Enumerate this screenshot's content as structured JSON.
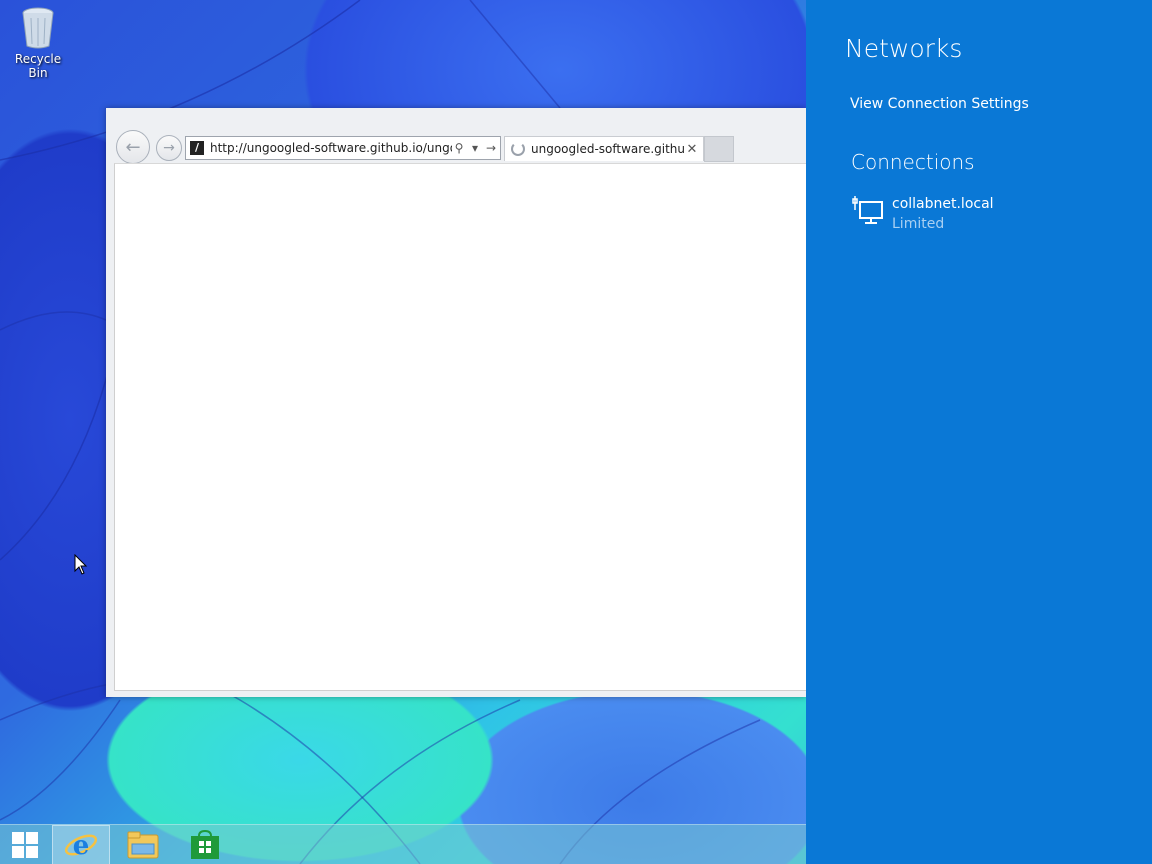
{
  "desktop": {
    "icons": [
      {
        "label": "Recycle Bin",
        "icon": "recycle-bin-icon"
      }
    ]
  },
  "browser": {
    "address_url": "http://ungoogled-software.github.io/ungoo",
    "tab_title": "ungoogled-software.github...",
    "tab_loading": true
  },
  "taskbar": {
    "items": [
      "start-button",
      "internet-explorer",
      "file-explorer",
      "store"
    ]
  },
  "networks_panel": {
    "title": "Networks",
    "view_settings_link": "View Connection Settings",
    "connections_heading": "Connections",
    "connections": [
      {
        "name": "collabnet.local",
        "status": "Limited",
        "icon": "wired-network-icon"
      }
    ]
  },
  "colors": {
    "charm_background": "#0a78d6",
    "status_text": "#a9d0f2"
  }
}
